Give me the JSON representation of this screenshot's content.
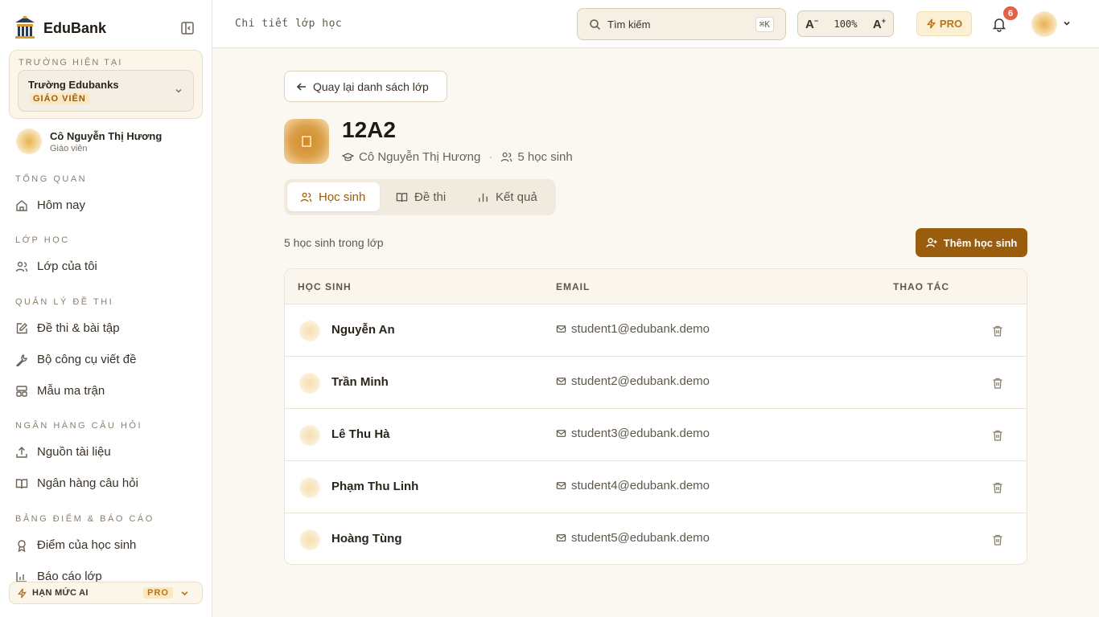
{
  "app": {
    "name": "EduBank"
  },
  "school": {
    "caption": "TRƯỜNG HIỆN TẠI",
    "name": "Trường Edubanks",
    "role": "GIÁO VIÊN"
  },
  "user": {
    "name": "Cô Nguyễn Thị Hương",
    "role": "Giáo viên"
  },
  "sidebar": {
    "sections": [
      {
        "title": "TỔNG QUAN",
        "items": [
          {
            "label": "Hôm nay",
            "icon": "home-icon"
          }
        ]
      },
      {
        "title": "LỚP HỌC",
        "items": [
          {
            "label": "Lớp của tôi",
            "icon": "users-icon"
          }
        ]
      },
      {
        "title": "QUẢN LÝ ĐỀ THI",
        "items": [
          {
            "label": "Đề thi & bài tập",
            "icon": "edit-icon"
          },
          {
            "label": "Bộ công cụ viết đề",
            "icon": "wrench-icon"
          },
          {
            "label": "Mẫu ma trận",
            "icon": "layout-icon"
          }
        ]
      },
      {
        "title": "NGÂN HÀNG CÂU HỎI",
        "items": [
          {
            "label": "Nguồn tài liệu",
            "icon": "upload-icon"
          },
          {
            "label": "Ngân hàng câu hỏi",
            "icon": "book-icon"
          }
        ]
      },
      {
        "title": "BẢNG ĐIỂM & BÁO CÁO",
        "items": [
          {
            "label": "Điểm của học sinh",
            "icon": "award-icon"
          },
          {
            "label": "Báo cáo lớp",
            "icon": "bar-chart-icon"
          }
        ]
      }
    ],
    "quota": {
      "label": "HẠN MỨC AI",
      "badge": "PRO"
    }
  },
  "header": {
    "breadcrumb": "Chi tiết lớp học",
    "search": {
      "placeholder": "Tìm kiếm",
      "shortcut": "⌘K"
    },
    "zoom": {
      "decrease": "A",
      "value": "100%",
      "increase": "A"
    },
    "pro_label": "PRO",
    "notifications": "6"
  },
  "main": {
    "back_label": "Quay lại danh sách lớp",
    "class": {
      "name": "12A2",
      "teacher": "Cô Nguyễn Thị Hương",
      "student_count": "5 học sinh"
    },
    "tabs": [
      {
        "label": "Học sinh",
        "icon": "users-icon",
        "active": true
      },
      {
        "label": "Đề thi",
        "icon": "book-icon",
        "active": false
      },
      {
        "label": "Kết quả",
        "icon": "bar-chart-icon",
        "active": false
      }
    ],
    "count_text": "5 học sinh trong lớp",
    "add_label": "Thêm học sinh",
    "table": {
      "headers": [
        "HỌC SINH",
        "EMAIL",
        "THAO TÁC"
      ],
      "rows": [
        {
          "name": "Nguyễn An",
          "email": "student1@edubank.demo"
        },
        {
          "name": "Trần Minh",
          "email": "student2@edubank.demo"
        },
        {
          "name": "Lê Thu Hà",
          "email": "student3@edubank.demo"
        },
        {
          "name": "Phạm Thu Linh",
          "email": "student4@edubank.demo"
        },
        {
          "name": "Hoàng Tùng",
          "email": "student5@edubank.demo"
        }
      ]
    }
  },
  "colors": {
    "accent": "#9a5d0d",
    "accent_light": "#fbefd4",
    "badge": "#e0624a",
    "background": "#fbf8f2"
  }
}
